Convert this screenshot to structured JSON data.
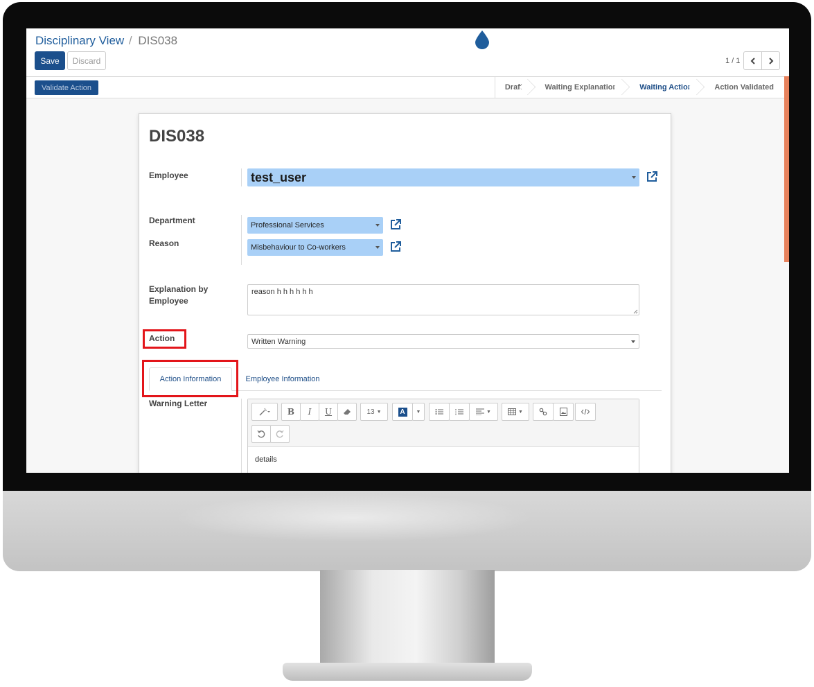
{
  "breadcrumb": {
    "parent": "Disciplinary View",
    "separator": "/",
    "current": "DIS038"
  },
  "buttons": {
    "save": "Save",
    "discard": "Discard",
    "validate_action": "Validate Action"
  },
  "pager": {
    "counter": "1 / 1"
  },
  "stages": [
    "Draft",
    "Waiting Explanation",
    "Waiting Action",
    "Action Validated"
  ],
  "active_stage": "Waiting Action",
  "record": {
    "title": "DIS038",
    "employee_label": "Employee",
    "employee_value": "test_user",
    "department_label": "Department",
    "department_value": "Professional Services",
    "reason_label": "Reason",
    "reason_value": "Misbehaviour to Co-workers",
    "explanation_label_line1": "Explanation by",
    "explanation_label_line2": "Employee",
    "explanation_value": "reason h h h h h  h",
    "action_label": "Action",
    "action_value": "Written Warning"
  },
  "tabs": {
    "active": "Action Information",
    "other": "Employee Information"
  },
  "editor": {
    "label": "Warning Letter",
    "font_size": "13",
    "content": "details"
  },
  "colors": {
    "brand": "#1b4f8c",
    "field_highlight": "#a9d0f7",
    "annotation": "#e3151a",
    "accent_strip": "#e7825d"
  }
}
